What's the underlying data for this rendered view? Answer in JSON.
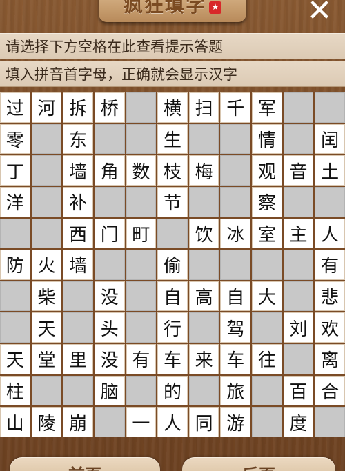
{
  "header": {
    "title": "疯狂填字",
    "close_glyph": "✕"
  },
  "hints": {
    "line1": "请选择下方空格在此查看提示答题",
    "line2": "填入拼音首字母，正确就会显示汉字"
  },
  "grid": [
    [
      "过",
      "河",
      "拆",
      "桥",
      "",
      "横",
      "扫",
      "千",
      "军",
      "",
      ""
    ],
    [
      "零",
      "",
      "东",
      "",
      "",
      "生",
      "",
      "",
      "情",
      "",
      "闰"
    ],
    [
      "丁",
      "",
      "墙",
      "角",
      "数",
      "枝",
      "梅",
      "",
      "观",
      "音",
      "土"
    ],
    [
      "洋",
      "",
      "补",
      "",
      "",
      "节",
      "",
      "",
      "察",
      "",
      ""
    ],
    [
      "",
      "",
      "西",
      "门",
      "町",
      "",
      "饮",
      "冰",
      "室",
      "主",
      "人"
    ],
    [
      "防",
      "火",
      "墙",
      "",
      "",
      "偷",
      "",
      "",
      "",
      "",
      "有"
    ],
    [
      "",
      "柴",
      "",
      "没",
      "",
      "自",
      "高",
      "自",
      "大",
      "",
      "悲"
    ],
    [
      "",
      "天",
      "",
      "头",
      "",
      "行",
      "",
      "驾",
      "",
      "刘",
      "欢"
    ],
    [
      "天",
      "堂",
      "里",
      "没",
      "有",
      "车",
      "来",
      "车",
      "往",
      "",
      "离"
    ],
    [
      "柱",
      "",
      "",
      "脑",
      "",
      "的",
      "",
      "旅",
      "",
      "百",
      "合"
    ],
    [
      "山",
      "陵",
      "崩",
      "",
      "一",
      "人",
      "同",
      "游",
      "",
      "度",
      ""
    ]
  ],
  "footer": {
    "prev_label": "前页",
    "next_label": "后页"
  }
}
